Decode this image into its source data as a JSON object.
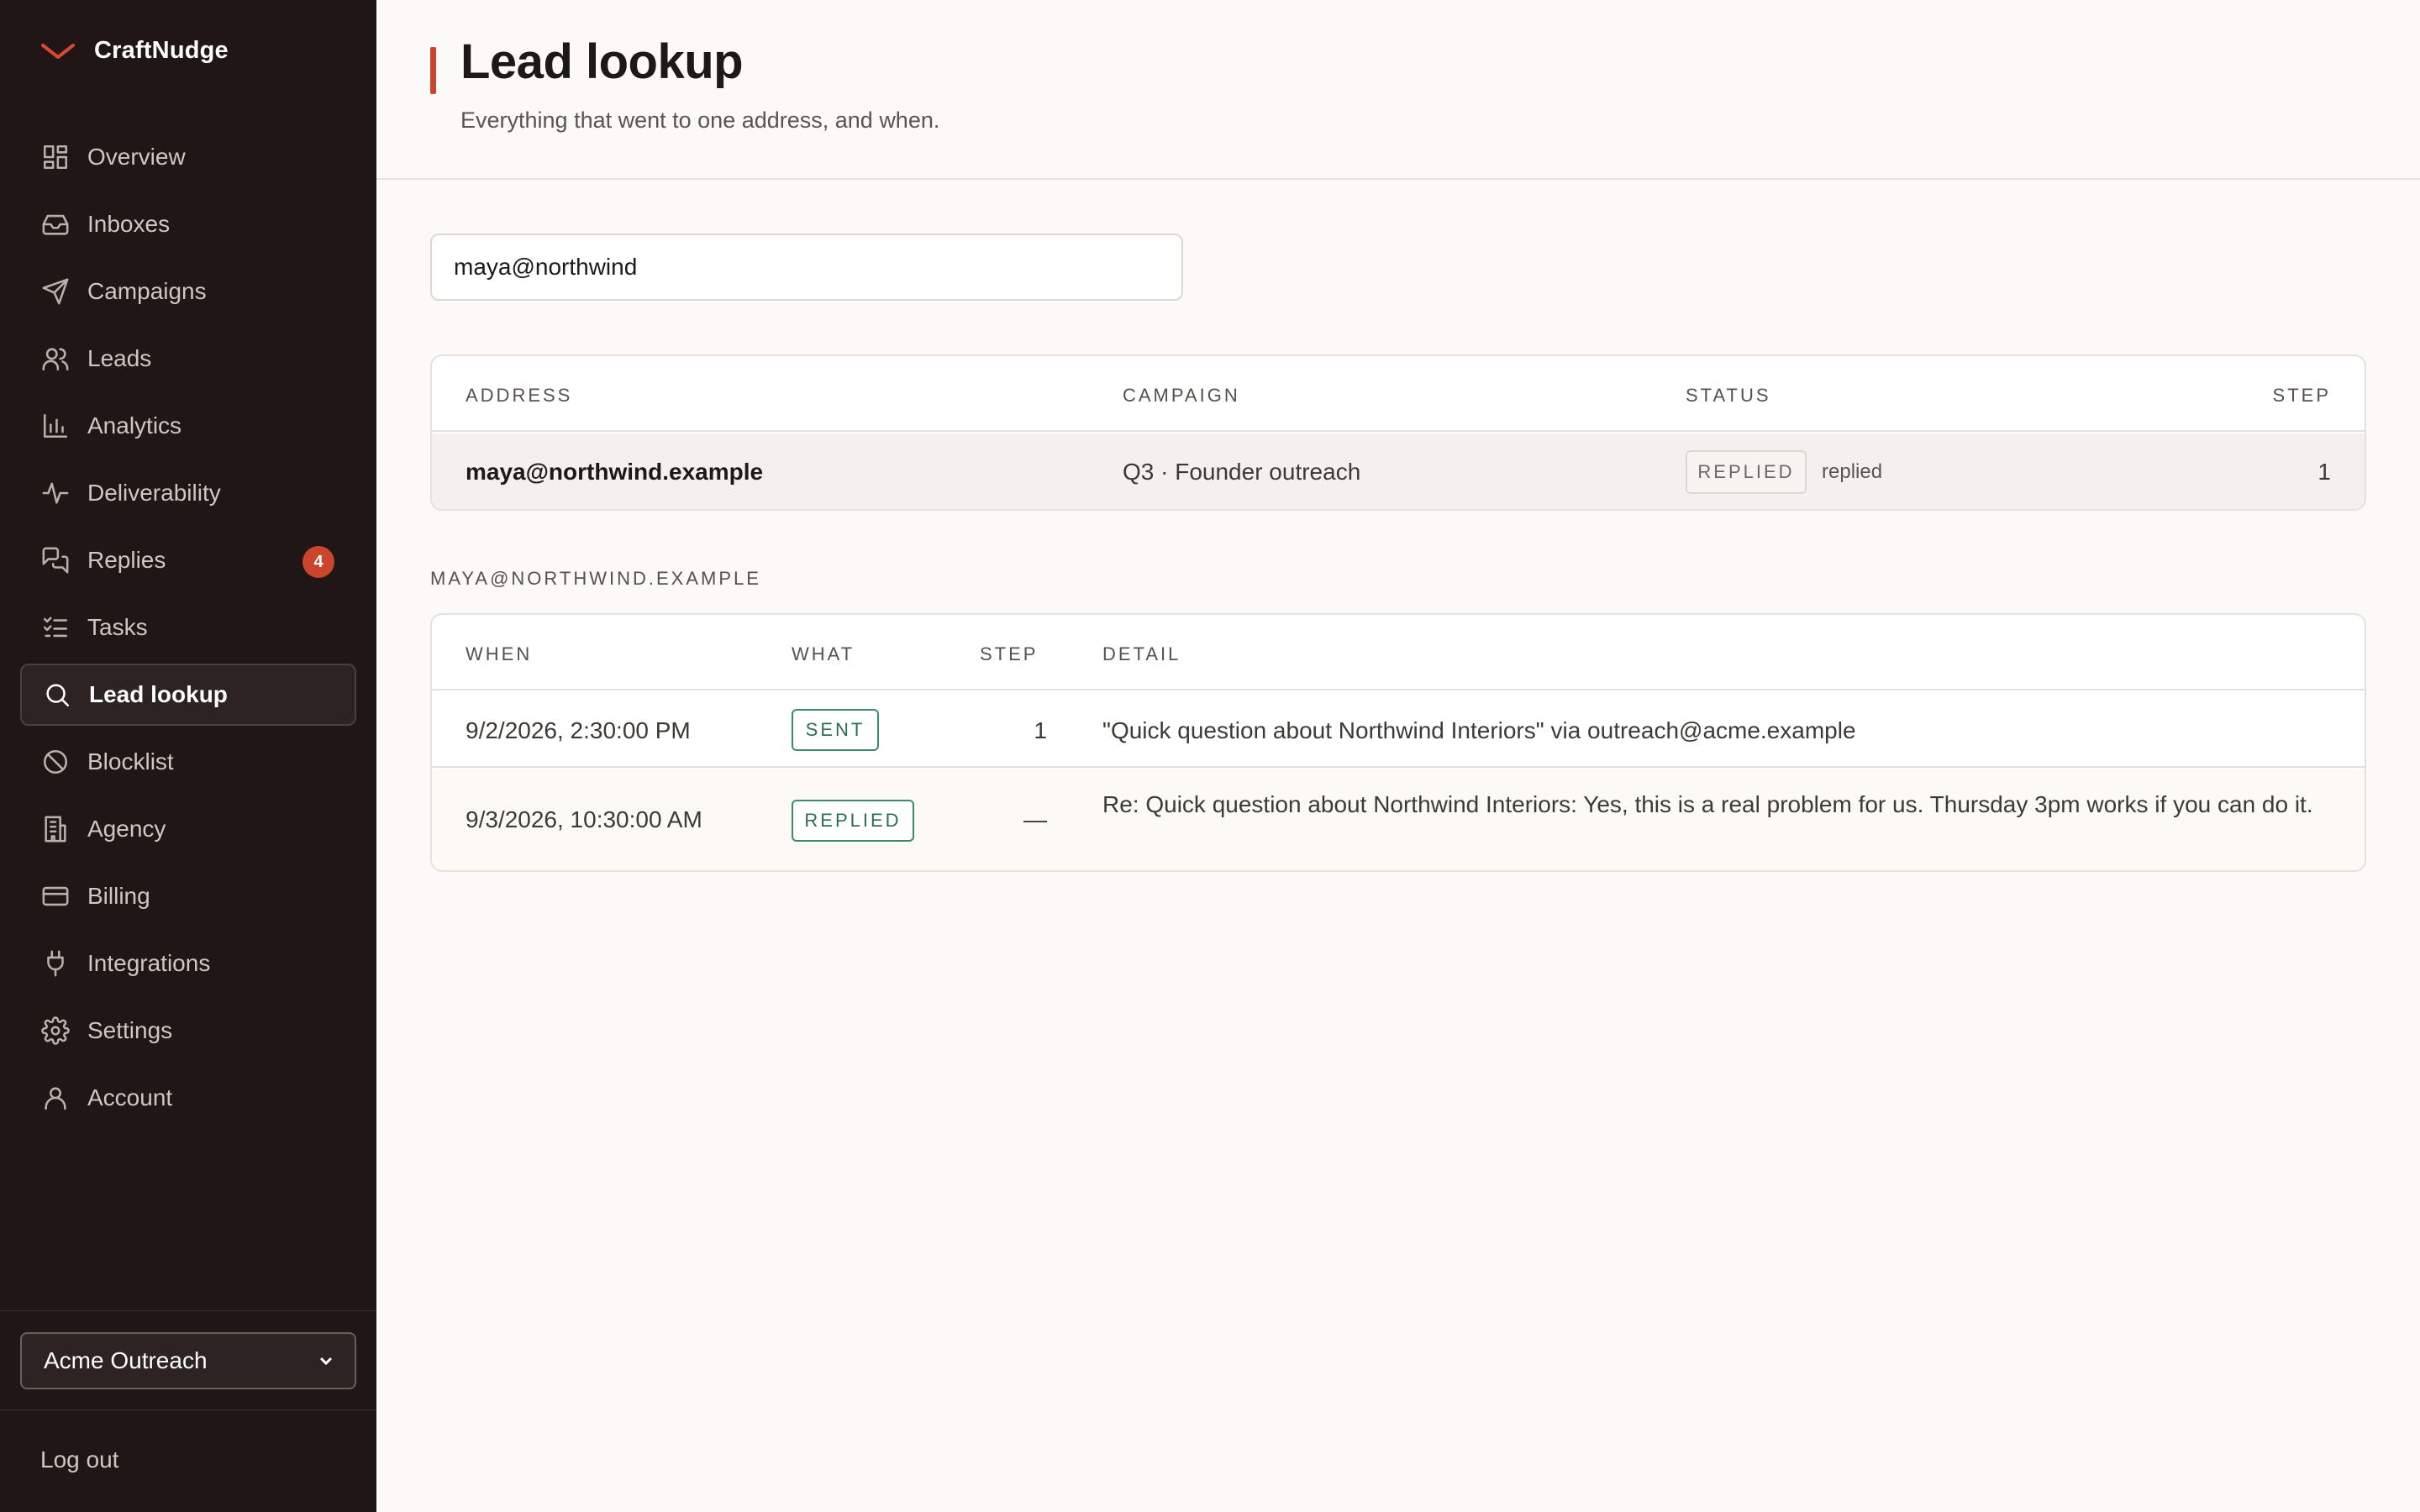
{
  "app": {
    "name": "CraftNudge"
  },
  "sidebar": {
    "items": [
      {
        "label": "Overview",
        "icon": "grid-icon"
      },
      {
        "label": "Inboxes",
        "icon": "inbox-icon"
      },
      {
        "label": "Campaigns",
        "icon": "send-icon"
      },
      {
        "label": "Leads",
        "icon": "users-icon"
      },
      {
        "label": "Analytics",
        "icon": "bar-chart-icon"
      },
      {
        "label": "Deliverability",
        "icon": "activity-icon"
      },
      {
        "label": "Replies",
        "icon": "messages-icon",
        "badge": "4"
      },
      {
        "label": "Tasks",
        "icon": "checklist-icon"
      },
      {
        "label": "Lead lookup",
        "icon": "search-icon",
        "active": true
      },
      {
        "label": "Blocklist",
        "icon": "ban-icon"
      },
      {
        "label": "Agency",
        "icon": "building-icon"
      },
      {
        "label": "Billing",
        "icon": "credit-card-icon"
      },
      {
        "label": "Integrations",
        "icon": "plug-icon"
      },
      {
        "label": "Settings",
        "icon": "gear-icon"
      },
      {
        "label": "Account",
        "icon": "user-icon"
      }
    ],
    "org": "Acme Outreach",
    "logout": "Log out"
  },
  "header": {
    "title": "Lead lookup",
    "subtitle": "Everything that went to one address, and when."
  },
  "search": {
    "value": "maya@northwind"
  },
  "results": {
    "columns": [
      "Address",
      "Campaign",
      "Status",
      "Step"
    ],
    "rows": [
      {
        "address": "maya@northwind.example",
        "campaign": "Q3 · Founder outreach",
        "status": "Replied",
        "status_note": "replied",
        "step": "1"
      }
    ]
  },
  "timeline": {
    "label": "maya@northwind.example",
    "columns": [
      "When",
      "What",
      "Step",
      "Detail"
    ],
    "rows": [
      {
        "when": "9/2/2026, 2:30:00 PM",
        "what": "Sent",
        "step": "1",
        "detail": "\"Quick question about Northwind Interiors\" via outreach@acme.example"
      },
      {
        "when": "9/3/2026, 10:30:00 AM",
        "what": "Replied",
        "step": "—",
        "detail": "Re: Quick question about Northwind Interiors: Yes, this is a real problem for us. Thursday 3pm works if you can do it."
      }
    ]
  },
  "colors": {
    "sidebar_bg": "#1f1615",
    "accent": "#c9452e",
    "success": "#2b6e57",
    "page_bg": "#fbfaf8"
  }
}
